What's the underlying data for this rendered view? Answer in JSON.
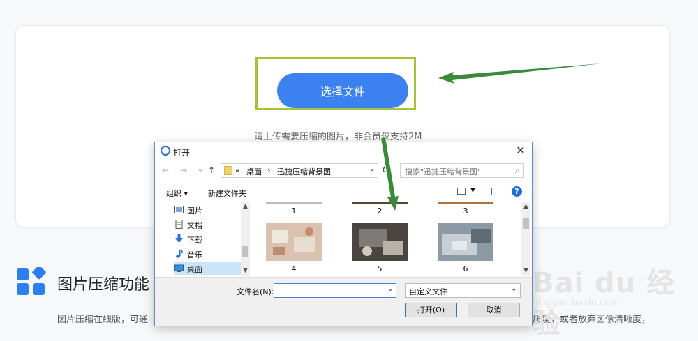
{
  "page": {
    "choose_file_label": "选择文件",
    "upload_hint": "请上传需要压缩的图片，非会员仅支持2M",
    "feature_title": "图片压缩功能",
    "feature_desc_left": "图片压缩在线版，可通",
    "feature_desc_right": "质量，或者放弃图像清晰度，"
  },
  "watermark": {
    "logo_text": "Bai du 经验",
    "url": "jingyan.baidu.com"
  },
  "dialog": {
    "title": "打开",
    "close": "✕",
    "nav": {
      "back": "←",
      "forward": "→",
      "recent": "⌄",
      "up": "↑"
    },
    "breadcrumb": [
      "«",
      "桌面",
      "›",
      "迅捷压缩背景图"
    ],
    "search_placeholder": "搜索\"迅捷压缩背景图\"",
    "toolbar": {
      "organize": "组织 ▾",
      "new_folder": "新建文件夹",
      "help": "?"
    },
    "sidebar_items": [
      {
        "label": "图片",
        "icon": "pictures-icon"
      },
      {
        "label": "文档",
        "icon": "documents-icon"
      },
      {
        "label": "下载",
        "icon": "download-icon"
      },
      {
        "label": "音乐",
        "icon": "music-icon"
      },
      {
        "label": "桌面",
        "icon": "desktop-icon",
        "selected": true
      }
    ],
    "files": [
      "1",
      "2",
      "3",
      "4",
      "5",
      "6"
    ],
    "filename_label": "文件名(N):",
    "filename_value": "",
    "filetype_value": "自定义文件",
    "open_button": "打开(O)",
    "cancel_button": "取消"
  },
  "colors": {
    "accent_button": "#3b82f0",
    "highlight_border": "#a4c23a",
    "annotation_arrow": "#3a8a3a"
  }
}
